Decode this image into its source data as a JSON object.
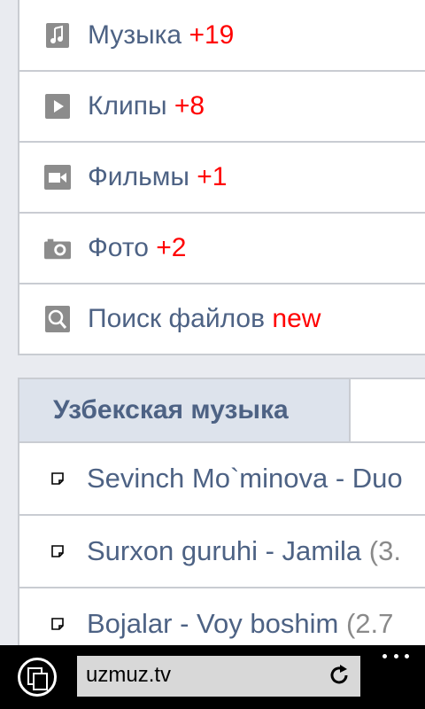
{
  "menu": {
    "items": [
      {
        "label": "Музыка",
        "badge": "+19",
        "icon": "music-note-icon"
      },
      {
        "label": "Клипы",
        "badge": "+8",
        "icon": "play-icon"
      },
      {
        "label": "Фильмы",
        "badge": "+1",
        "icon": "video-camera-icon"
      },
      {
        "label": "Фото",
        "badge": "+2",
        "icon": "camera-icon"
      },
      {
        "label": "Поиск файлов",
        "badge": "new",
        "icon": "search-file-icon"
      }
    ]
  },
  "section": {
    "active_tab": "Узбекская музыка",
    "tracks": [
      {
        "title": "Sevinch Mo`minova - Duo",
        "size": ""
      },
      {
        "title": "Surxon guruhi - Jamila",
        "size": "(3."
      },
      {
        "title": "Bojalar - Voy boshim",
        "size": "(2.7"
      }
    ]
  },
  "browser": {
    "url": "uzmuz.tv"
  },
  "colors": {
    "link": "#4d6284",
    "badge": "#ff0000",
    "tab_bg": "#dde3ec"
  }
}
